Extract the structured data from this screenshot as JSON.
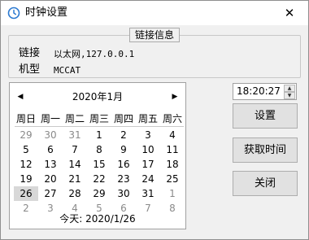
{
  "window": {
    "title": "时钟设置",
    "close_symbol": "✕",
    "icon": "clock-icon"
  },
  "info_group": {
    "legend": "链接信息",
    "rows": [
      {
        "label": "链接",
        "value": "以太网,127.0.0.1"
      },
      {
        "label": "机型",
        "value": "MCCAT"
      }
    ]
  },
  "calendar": {
    "month_title": "2020年1月",
    "prev_symbol": "◀",
    "next_symbol": "▶",
    "weekdays": [
      "周日",
      "周一",
      "周二",
      "周三",
      "周四",
      "周五",
      "周六"
    ],
    "weeks": [
      [
        {
          "d": "29",
          "other": true
        },
        {
          "d": "30",
          "other": true
        },
        {
          "d": "31",
          "other": true
        },
        {
          "d": "1"
        },
        {
          "d": "2"
        },
        {
          "d": "3"
        },
        {
          "d": "4"
        }
      ],
      [
        {
          "d": "5"
        },
        {
          "d": "6"
        },
        {
          "d": "7"
        },
        {
          "d": "8"
        },
        {
          "d": "9"
        },
        {
          "d": "10"
        },
        {
          "d": "11"
        }
      ],
      [
        {
          "d": "12"
        },
        {
          "d": "13"
        },
        {
          "d": "14"
        },
        {
          "d": "15"
        },
        {
          "d": "16"
        },
        {
          "d": "17"
        },
        {
          "d": "18"
        }
      ],
      [
        {
          "d": "19"
        },
        {
          "d": "20"
        },
        {
          "d": "21"
        },
        {
          "d": "22"
        },
        {
          "d": "23"
        },
        {
          "d": "24"
        },
        {
          "d": "25"
        }
      ],
      [
        {
          "d": "26",
          "selected": true
        },
        {
          "d": "27"
        },
        {
          "d": "28"
        },
        {
          "d": "29"
        },
        {
          "d": "30"
        },
        {
          "d": "31"
        },
        {
          "d": "1",
          "other": true
        }
      ],
      [
        {
          "d": "2",
          "other": true
        },
        {
          "d": "3",
          "other": true
        },
        {
          "d": "4",
          "other": true
        },
        {
          "d": "5",
          "other": true
        },
        {
          "d": "6",
          "other": true
        },
        {
          "d": "7",
          "other": true
        },
        {
          "d": "8",
          "other": true
        }
      ]
    ],
    "today_label": "今天: 2020/1/26"
  },
  "time_picker": {
    "value": "18:20:27",
    "up_symbol": "▲",
    "down_symbol": "▼"
  },
  "buttons": {
    "set": "设置",
    "get_time": "获取时间",
    "close": "关闭"
  }
}
